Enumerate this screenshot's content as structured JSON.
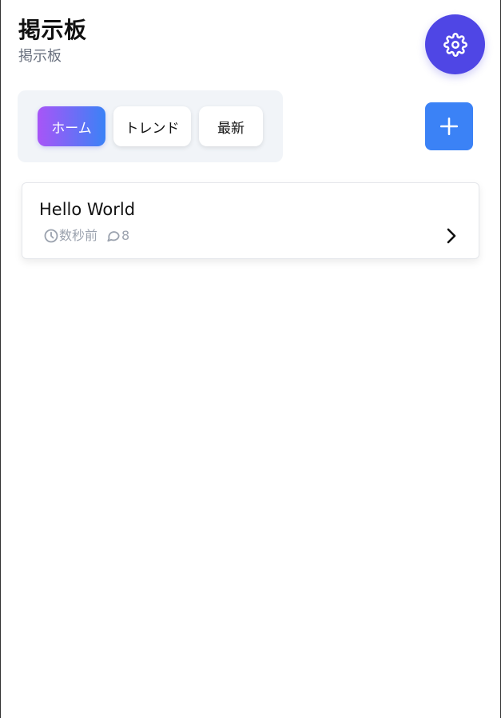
{
  "header": {
    "title": "掲示板",
    "subtitle": "掲示板"
  },
  "tabs": [
    {
      "label": "ホーム",
      "active": true
    },
    {
      "label": "トレンド",
      "active": false
    },
    {
      "label": "最新",
      "active": false
    }
  ],
  "icons": {
    "settings": "gear-icon",
    "add": "plus-icon",
    "time": "clock-icon",
    "comments": "comment-icon",
    "open": "chevron-right-icon"
  },
  "colors": {
    "settings_button": "#4f46e5",
    "add_button": "#3b82f6",
    "active_tab_gradient_start": "#a855f7",
    "active_tab_gradient_end": "#3b82f6",
    "tab_bar_background": "#f1f4f8",
    "meta_text": "#9ca3af"
  },
  "posts": [
    {
      "title": "Hello World",
      "time": "数秒前",
      "comments": "8"
    }
  ]
}
